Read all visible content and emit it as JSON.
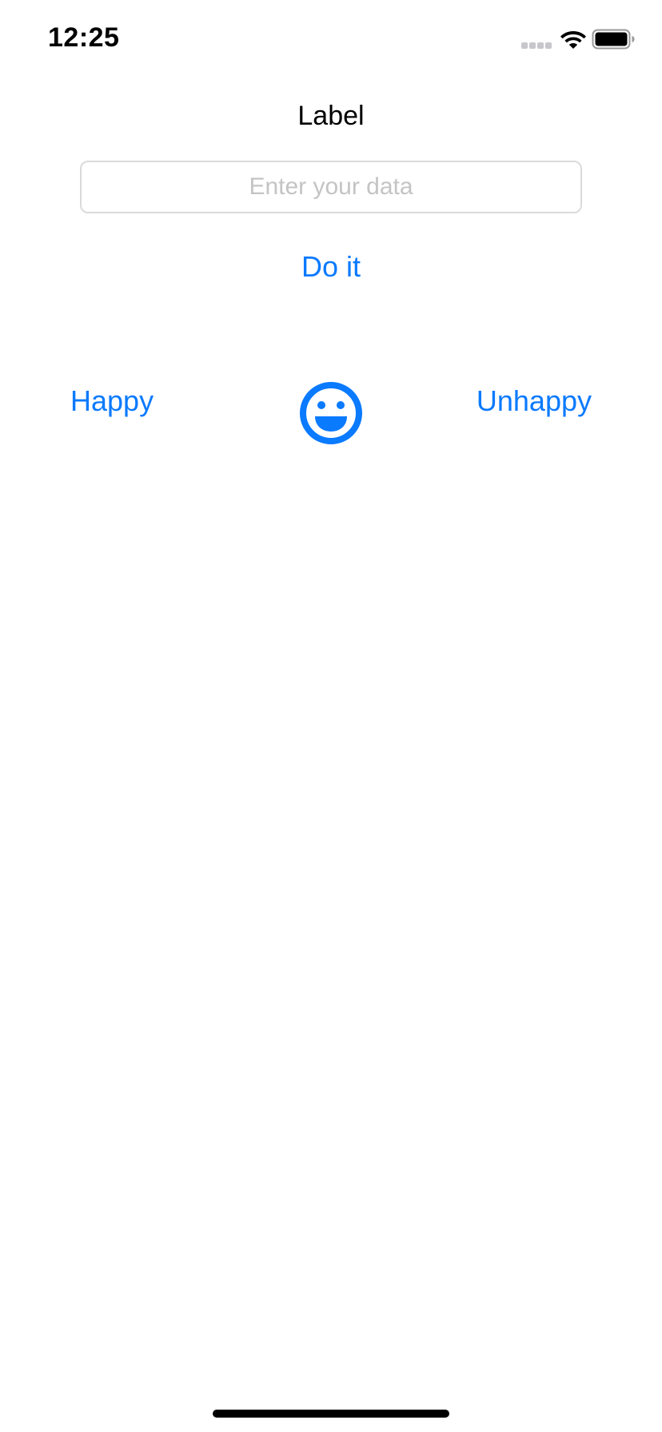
{
  "status_bar": {
    "time": "12:25"
  },
  "main": {
    "title_label": "Label",
    "input": {
      "value": "",
      "placeholder": "Enter your data"
    },
    "do_it_label": "Do it",
    "happy_label": "Happy",
    "unhappy_label": "Unhappy",
    "mood_icon": "smiley-face-icon"
  },
  "colors": {
    "accent": "#0a7aff",
    "text": "#000000",
    "placeholder": "#c4c4c6",
    "border": "#dadada",
    "background": "#ffffff"
  }
}
